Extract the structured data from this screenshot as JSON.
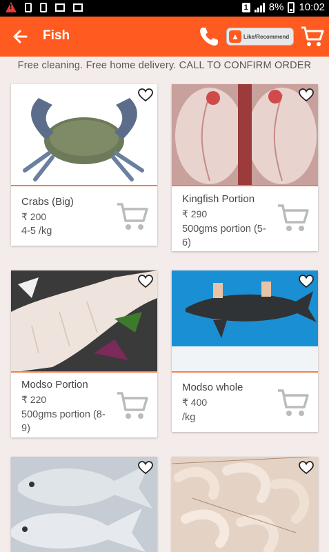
{
  "status": {
    "sim": "1",
    "battery": "8%",
    "time": "10:02"
  },
  "appbar": {
    "title": "Fish",
    "like_label": "Like/Recommend"
  },
  "banner": "Free cleaning. Free home delivery. CALL TO CONFIRM ORDER",
  "products": [
    {
      "name": "Crabs (Big)",
      "price": "₹ 200",
      "qty": "4-5 /kg"
    },
    {
      "name": "Kingfish Portion",
      "price": "₹ 290",
      "qty": "500gms portion (5-6)"
    },
    {
      "name": "Modso Portion",
      "price": "₹ 220",
      "qty": "500gms portion (8-9)"
    },
    {
      "name": "Modso whole",
      "price": "₹ 400",
      "qty": "/kg"
    }
  ],
  "colors": {
    "accent": "#ff5a1f",
    "background": "#f4ecea"
  }
}
